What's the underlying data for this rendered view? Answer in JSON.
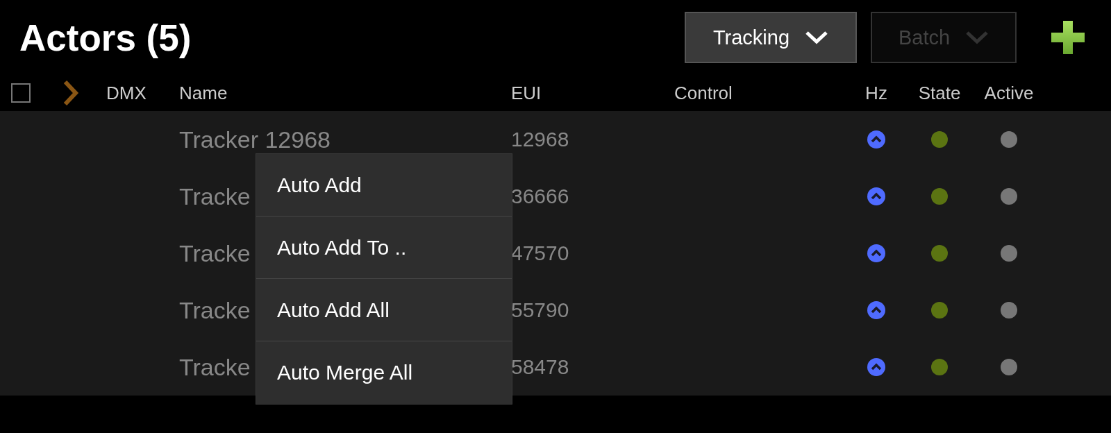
{
  "header": {
    "title": "Actors (5)",
    "buttons": [
      {
        "label": "Tracking",
        "disabled": false
      },
      {
        "label": "Batch",
        "disabled": true
      }
    ]
  },
  "table": {
    "select_all": {
      "checked": false
    },
    "columns": [
      "DMX",
      "Name",
      "EUI",
      "Control",
      "Hz",
      "State",
      "Active"
    ],
    "rows": [
      {
        "name": "Tracker 12968",
        "eui": "12968",
        "online": true,
        "active": false
      },
      {
        "name": "Tracke",
        "eui": "36666",
        "online": true,
        "active": false
      },
      {
        "name": "Tracke",
        "eui": "47570",
        "online": true,
        "active": false
      },
      {
        "name": "Tracke",
        "eui": "55790",
        "online": true,
        "active": false
      },
      {
        "name": "Tracke",
        "eui": "58478",
        "online": true,
        "active": false
      }
    ]
  },
  "context_menu": {
    "items": [
      "Auto Add",
      "Auto Add To ..",
      "Auto Add All",
      "Auto Merge All"
    ]
  }
}
